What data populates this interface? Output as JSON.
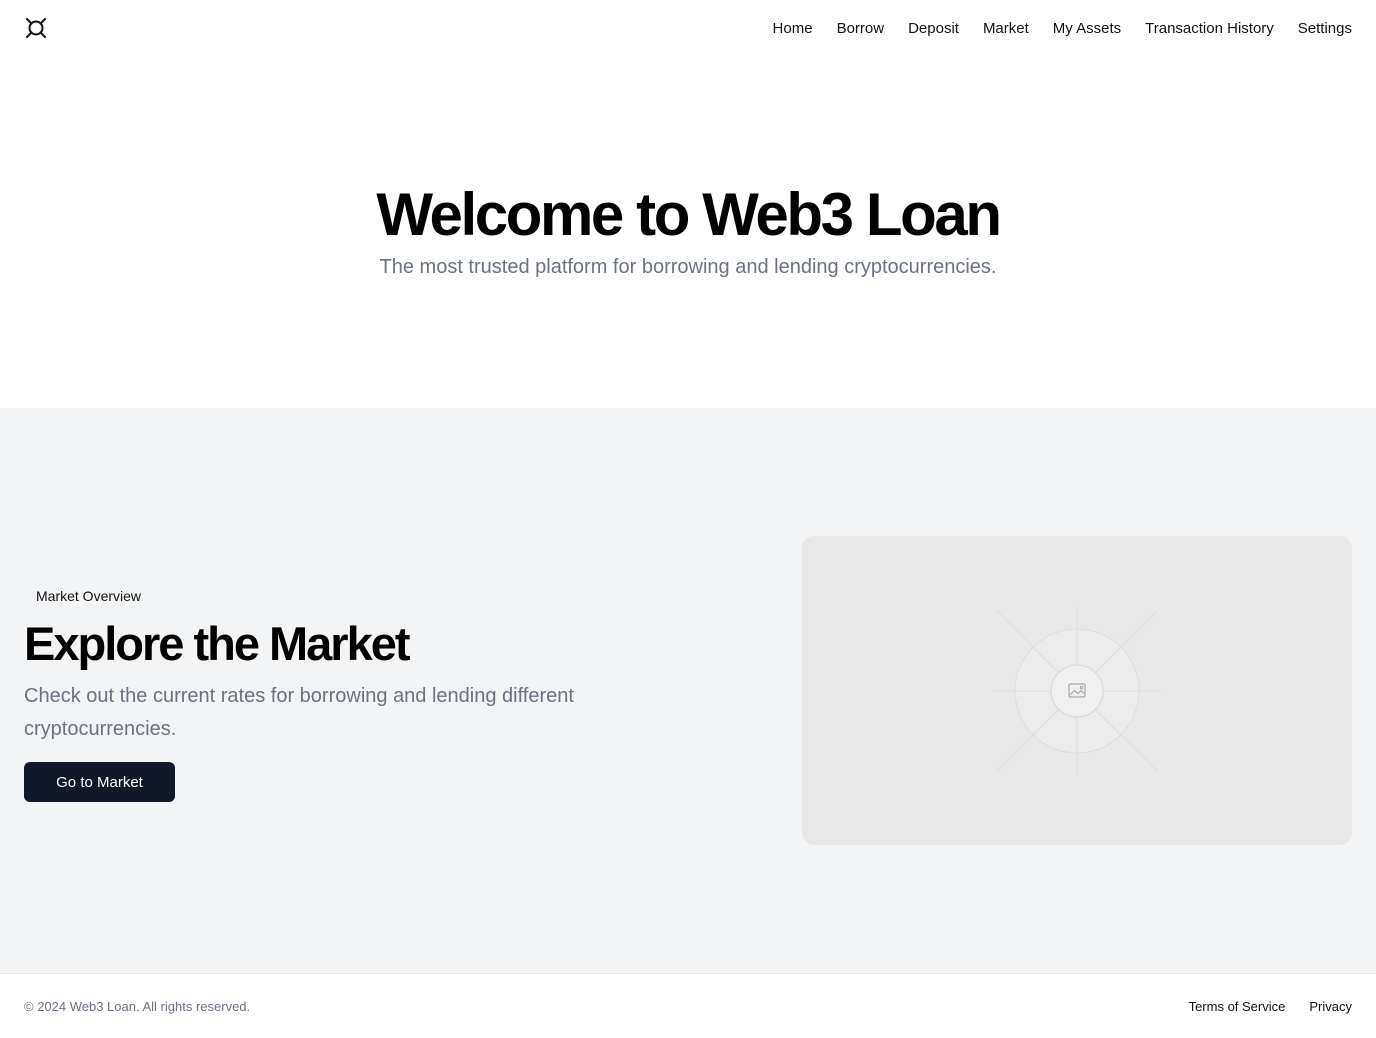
{
  "header": {
    "logo_icon": "aperture-logo-icon",
    "nav": [
      {
        "label": "Home"
      },
      {
        "label": "Borrow"
      },
      {
        "label": "Deposit"
      },
      {
        "label": "Market"
      },
      {
        "label": "My Assets"
      },
      {
        "label": "Transaction History"
      },
      {
        "label": "Settings"
      }
    ]
  },
  "hero": {
    "title": "Welcome to Web3 Loan",
    "subtitle": "The most trusted platform for borrowing and lending cryptocurrencies."
  },
  "market": {
    "tagline": "Market Overview",
    "title": "Explore the Market",
    "description": "Check out the current rates for borrowing and lending different cryptocurrencies.",
    "button_label": "Go to Market",
    "image_icon": "image-placeholder-icon"
  },
  "footer": {
    "copyright": "© 2024 Web3 Loan. All rights reserved.",
    "links": [
      {
        "label": "Terms of Service"
      },
      {
        "label": "Privacy"
      }
    ]
  },
  "colors": {
    "primary_button": "#111827",
    "section_background": "#f2f4f6",
    "muted_text": "#6b7280"
  }
}
